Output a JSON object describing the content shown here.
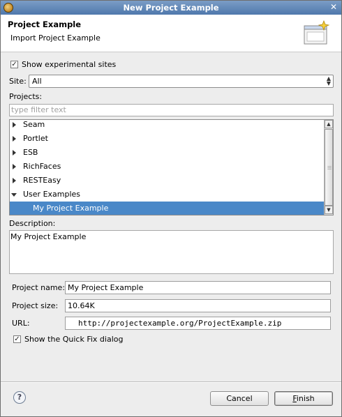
{
  "window": {
    "title": "New Project Example"
  },
  "header": {
    "title": "Project Example",
    "subtitle": "Import Project Example",
    "wizard_image": "wizard-banner-icon"
  },
  "options": {
    "show_experimental_label": "Show experimental sites",
    "show_experimental_checked": true
  },
  "site": {
    "label": "Site:",
    "value": "All"
  },
  "projects": {
    "label": "Projects:",
    "filter_placeholder": "type filter text",
    "tree": [
      {
        "label": "Seam",
        "expanded": false
      },
      {
        "label": "Portlet",
        "expanded": false
      },
      {
        "label": "ESB",
        "expanded": false
      },
      {
        "label": "RichFaces",
        "expanded": false
      },
      {
        "label": "RESTEasy",
        "expanded": false
      },
      {
        "label": "User Examples",
        "expanded": true
      },
      {
        "label": "My Project Example",
        "child": true,
        "selected": true
      }
    ]
  },
  "description": {
    "label": "Description:",
    "text": "My Project Example"
  },
  "details": {
    "name_label": "Project name:",
    "name_value": "My Project Example",
    "size_label": "Project size:",
    "size_value": "10.64K",
    "url_label": "URL:",
    "url_value": "http://projectexample.org/ProjectExample.zip"
  },
  "quick_fix": {
    "label": "Show the Quick Fix dialog",
    "checked": true
  },
  "footer": {
    "help_glyph": "?",
    "cancel_label": "Cancel",
    "finish_label_first": "F",
    "finish_label_rest": "inish"
  },
  "colors": {
    "title_bar": "#5a82b4",
    "selection": "#4a88c8"
  }
}
